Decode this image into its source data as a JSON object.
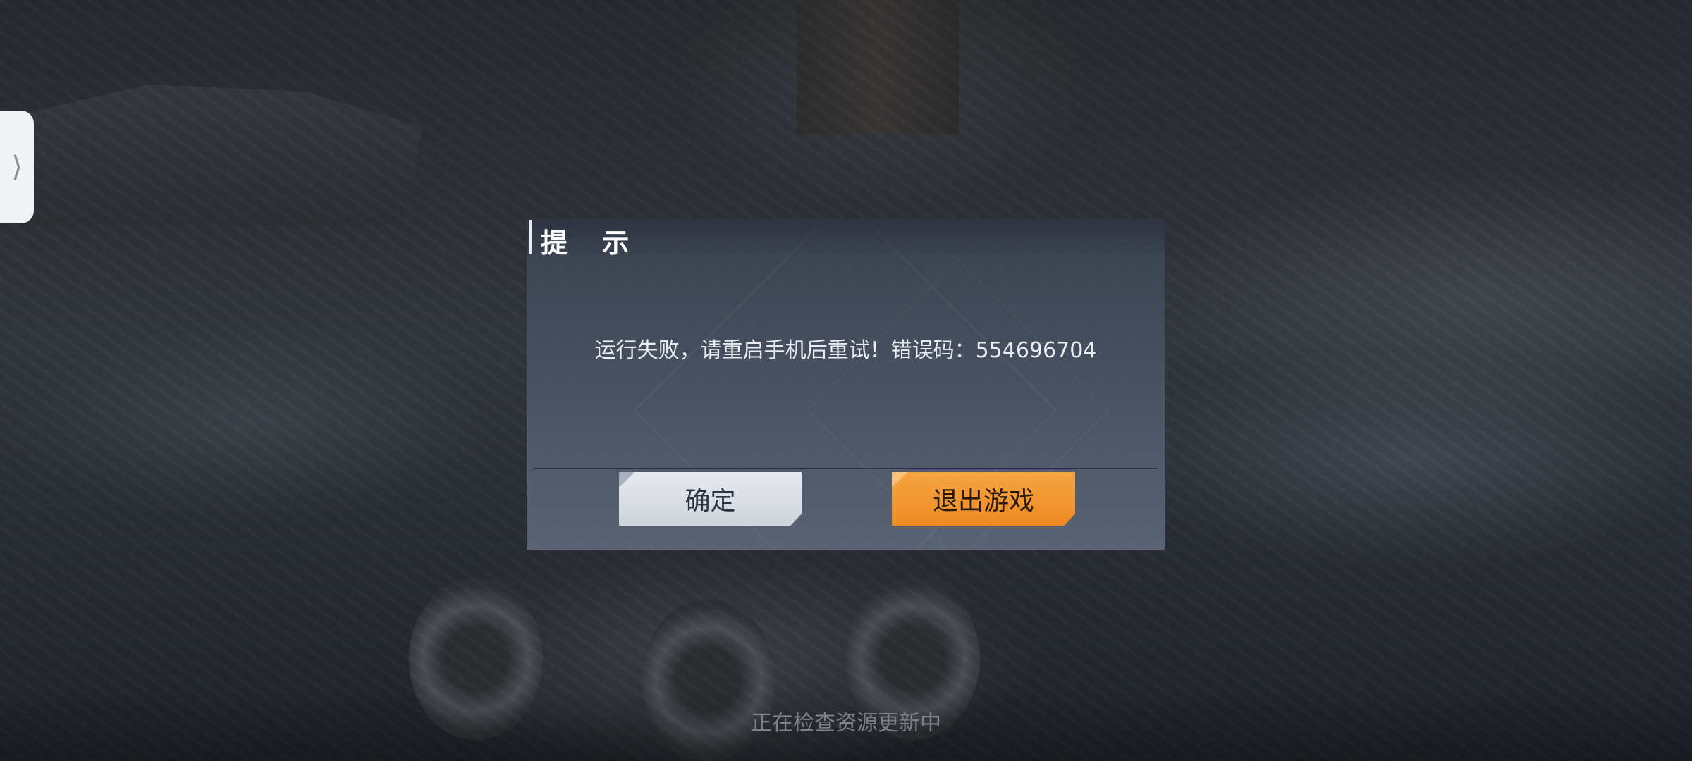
{
  "side_panel": {
    "handle_glyph": "⟩",
    "icon": "chevron-right-icon"
  },
  "dialog": {
    "title": "提 示",
    "message": "运行失败，请重启手机后重试！错误码：554696704",
    "buttons": {
      "confirm_label": "确定",
      "exit_label": "退出游戏"
    }
  },
  "status": {
    "text": "正在检查资源更新中"
  },
  "colors": {
    "accent_orange": "#ee8a23",
    "confirm_button": "#dde1e8",
    "dialog_bg": "#485262"
  }
}
